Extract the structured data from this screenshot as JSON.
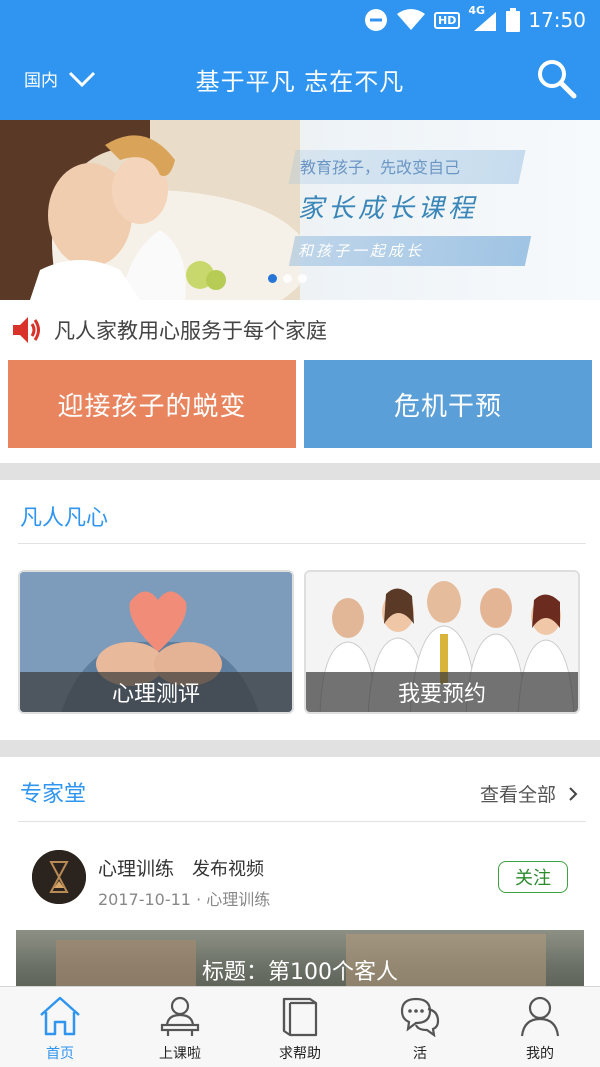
{
  "status_bar": {
    "time": "17:50",
    "network": "4G",
    "hd": "HD"
  },
  "header": {
    "region": "国内",
    "title": "基于平凡 志在不凡"
  },
  "banner": {
    "subtitle": "教育孩子，先改变自己",
    "headline": "家长成长课程",
    "tagline": "和孩子一起成长",
    "slides": 3,
    "active_slide": 1
  },
  "notice": {
    "text": "凡人家教用心服务于每个家庭"
  },
  "actions": {
    "left": "迎接孩子的蜕变",
    "right": "危机干预"
  },
  "section1": {
    "title": "凡人凡心",
    "tiles": [
      {
        "label": "心理测评"
      },
      {
        "label": "我要预约"
      }
    ]
  },
  "section2": {
    "title": "专家堂",
    "more": "查看全部",
    "post": {
      "author": "心理训练",
      "action": "发布视频",
      "meta": "2017-10-11 · 心理训练",
      "follow": "关注",
      "video_title": "标题：第100个客人"
    }
  },
  "tabs": [
    {
      "label": "首页",
      "icon": "home-icon",
      "active": true
    },
    {
      "label": "上课啦",
      "icon": "class-icon",
      "active": false
    },
    {
      "label": "求帮助",
      "icon": "book-icon",
      "active": false
    },
    {
      "label": "活",
      "icon": "chat-icon",
      "active": false
    },
    {
      "label": "我的",
      "icon": "profile-icon",
      "active": false
    }
  ],
  "colors": {
    "primary": "#2f95f0",
    "orange": "#e8855f",
    "blue": "#5b9fd8",
    "follow_green": "#3da23f"
  }
}
